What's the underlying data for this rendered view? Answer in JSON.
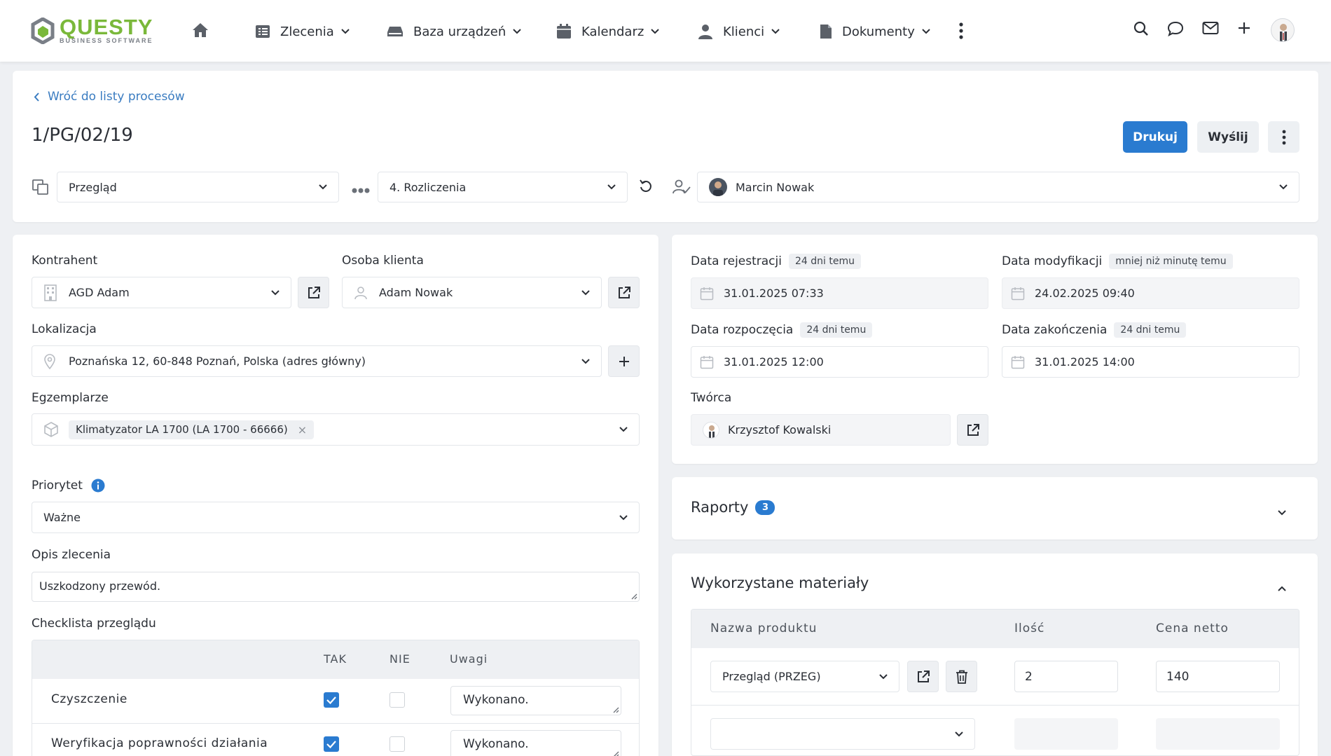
{
  "brand": {
    "name": "QUESTY",
    "tagline": "BUSINESS SOFTWARE",
    "accent": "#7ab83a"
  },
  "nav": {
    "items": [
      {
        "label": "Zlecenia",
        "icon": "list-icon"
      },
      {
        "label": "Baza urządzeń",
        "icon": "device-icon"
      },
      {
        "label": "Kalendarz",
        "icon": "calendar-icon"
      },
      {
        "label": "Klienci",
        "icon": "person-icon"
      },
      {
        "label": "Dokumenty",
        "icon": "document-icon"
      }
    ]
  },
  "header": {
    "back_label": "Wróć do listy procesów",
    "title": "1/PG/02/19",
    "print_label": "Drukuj",
    "send_label": "Wyślij",
    "process_type": "Przegląd",
    "stage": "4. Rozliczenia",
    "assignee": "Marcin Nowak"
  },
  "left": {
    "contractor_label": "Kontrahent",
    "contractor_value": "AGD Adam",
    "client_person_label": "Osoba klienta",
    "client_person_value": "Adam Nowak",
    "location_label": "Lokalizacja",
    "location_value": "Poznańska 12, 60-848 Poznań, Polska (adres główny)",
    "units_label": "Egzemplarze",
    "unit_chip": "Klimatyzator LA 1700 (LA 1700 - 66666)",
    "unit_chip_remove": "×",
    "priority_label": "Priorytet",
    "priority_value": "Ważne",
    "description_label": "Opis zlecenia",
    "description_value": "Uszkodzony przewód.",
    "checklist_label": "Checklista przeglądu",
    "checklist_headers": {
      "yes": "TAK",
      "no": "NIE",
      "notes": "Uwagi"
    },
    "checklist_rows": [
      {
        "name": "Czyszczenie",
        "yes": true,
        "no": false,
        "notes": "Wykonano."
      },
      {
        "name": "Weryfikacja poprawności działania",
        "yes": true,
        "no": false,
        "notes": "Wykonano."
      }
    ]
  },
  "right": {
    "reg_label": "Data rejestracji",
    "reg_badge": "24 dni temu",
    "reg_value": "31.01.2025 07:33",
    "mod_label": "Data modyfikacji",
    "mod_badge": "mniej niż minutę temu",
    "mod_value": "24.02.2025 09:40",
    "start_label": "Data rozpoczęcia",
    "start_badge": "24 dni temu",
    "start_value": "31.01.2025 12:00",
    "end_label": "Data zakończenia",
    "end_badge": "24 dni temu",
    "end_value": "31.01.2025 14:00",
    "creator_label": "Twórca",
    "creator_value": "Krzysztof Kowalski"
  },
  "reports": {
    "title": "Raporty",
    "count": "3"
  },
  "materials": {
    "title": "Wykorzystane materiały",
    "headers": {
      "product": "Nazwa produktu",
      "qty": "Ilość",
      "price": "Cena netto"
    },
    "rows": [
      {
        "product": "Przegląd (PRZEG)",
        "qty": "2",
        "price": "140"
      }
    ]
  }
}
